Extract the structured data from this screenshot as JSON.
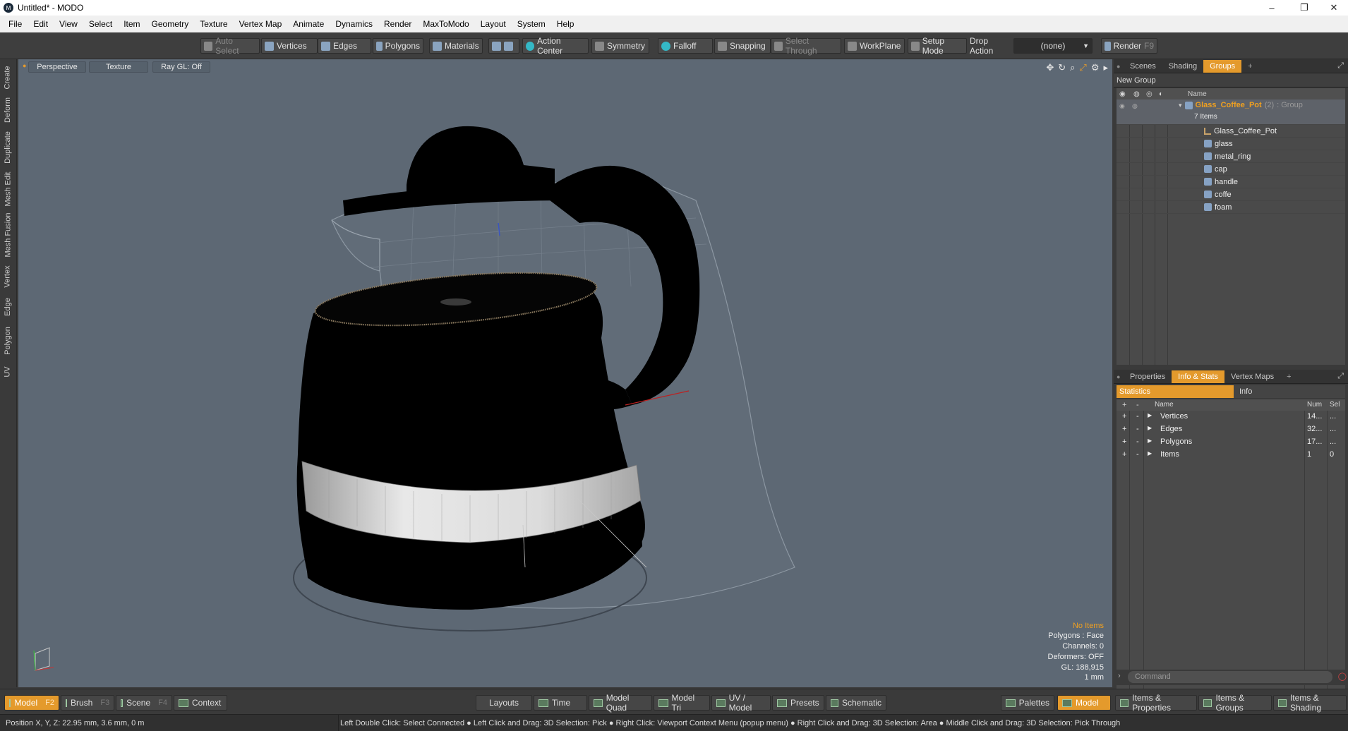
{
  "window": {
    "title": "Untitled* - MODO",
    "minimize": "–",
    "maximize": "❐",
    "close": "✕"
  },
  "menu": [
    "File",
    "Edit",
    "View",
    "Select",
    "Item",
    "Geometry",
    "Texture",
    "Vertex Map",
    "Animate",
    "Dynamics",
    "Render",
    "MaxToModo",
    "Layout",
    "System",
    "Help"
  ],
  "toolbar": {
    "auto_select": "Auto Select",
    "vertices": "Vertices",
    "edges": "Edges",
    "polygons": "Polygons",
    "materials": "Materials",
    "action_center": "Action Center",
    "symmetry": "Symmetry",
    "falloff": "Falloff",
    "snapping": "Snapping",
    "select_through": "Select Through",
    "workplane": "WorkPlane",
    "setup_mode": "Setup Mode",
    "drop_action": "Drop Action",
    "drop_value": "(none)",
    "render": "Render",
    "render_key": "F9"
  },
  "left_tabs": [
    "Create",
    "Deform",
    "Duplicate",
    "Mesh Edit",
    "Mesh Fusion",
    "Vertex",
    "Edge",
    "Polygon",
    "UV"
  ],
  "viewport": {
    "view": "Perspective",
    "shading": "Texture",
    "raygl": "Ray GL: Off",
    "hud": {
      "items": "No Items",
      "polygons": "Polygons : Face",
      "channels": "Channels: 0",
      "deformers": "Deformers: OFF",
      "gl": "GL: 188,915",
      "scale": "1 mm"
    }
  },
  "groups_panel": {
    "tabs": [
      "Scenes",
      "Shading",
      "Groups",
      "+"
    ],
    "new_group": "New Group",
    "name_col": "Name",
    "root": {
      "name": "Glass_Coffee_Pot",
      "count": "(2)",
      "type": ": Group",
      "items": "7 Items"
    },
    "children": [
      "Glass_Coffee_Pot",
      "glass",
      "metal_ring",
      "cap",
      "handle",
      "coffe",
      "foam"
    ]
  },
  "stats_panel": {
    "tabs": [
      "Properties",
      "Info & Stats",
      "Vertex Maps",
      "+"
    ],
    "sub_tabs": [
      "Statistics",
      "Info"
    ],
    "columns": [
      "Name",
      "Num",
      "Sel"
    ],
    "rows": [
      {
        "name": "Vertices",
        "num": "14...",
        "sel": "..."
      },
      {
        "name": "Edges",
        "num": "32...",
        "sel": "..."
      },
      {
        "name": "Polygons",
        "num": "17...",
        "sel": "..."
      },
      {
        "name": "Items",
        "num": "1",
        "sel": "0"
      }
    ]
  },
  "command": {
    "placeholder": "Command"
  },
  "bottom_bar": {
    "model": "Model",
    "model_key": "F2",
    "brush": "Brush",
    "brush_key": "F3",
    "scene": "Scene",
    "scene_key": "F4",
    "context": "Context",
    "layouts": "Layouts",
    "time": "Time",
    "model_quad": "Model Quad",
    "model_tri": "Model Tri",
    "uv_model": "UV / Model",
    "presets": "Presets",
    "schematic": "Schematic",
    "palettes": "Palettes",
    "model2": "Model",
    "items_props": "Items & Properties",
    "items_groups": "Items & Groups",
    "items_shading": "Items & Shading"
  },
  "status": {
    "position": "Position X, Y, Z:   22.95 mm, 3.6 mm, 0 m",
    "hint": "Left Double Click: Select Connected ● Left Click and Drag: 3D Selection: Pick ● Right Click: Viewport Context Menu (popup menu) ● Right Click and Drag: 3D Selection: Area ● Middle Click and Drag: 3D Selection: Pick Through"
  },
  "colors": {
    "accent": "#e49a2c",
    "viewport_bg": "#5d6874",
    "warn": "#f0a020"
  }
}
